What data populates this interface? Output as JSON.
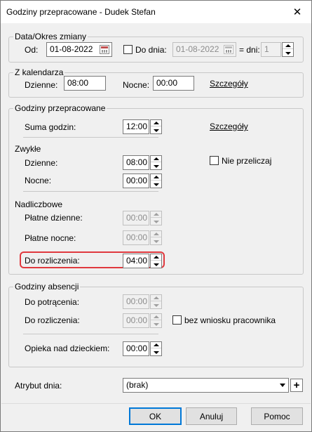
{
  "window": {
    "title": "Godziny przepracowane - Dudek Stefan",
    "close": "✕"
  },
  "data_okres": {
    "legend": "Data/Okres zmiany",
    "od_label": "Od:",
    "od_value": "01-08-2022",
    "do_dnia_label": "Do dnia:",
    "do_dnia_checked": false,
    "do_dnia_value": "01-08-2022",
    "dni_label": "= dni:",
    "dni_value": "1"
  },
  "z_kalendarza": {
    "legend": "Z kalendarza",
    "dzienne_label": "Dzienne:",
    "dzienne_value": "08:00",
    "nocne_label": "Nocne:",
    "nocne_value": "00:00",
    "szczegoly": "Szczegóły"
  },
  "godziny_przepracowane": {
    "legend": "Godziny przepracowane",
    "suma_label": "Suma godzin:",
    "suma_value": "12:00",
    "szczegoly": "Szczegóły",
    "zwykle_label": "Zwykłe",
    "dzienne_label": "Dzienne:",
    "dzienne_value": "08:00",
    "nocne_label": "Nocne:",
    "nocne_value": "00:00",
    "nie_przeliczaj_label": "Nie przeliczaj",
    "nadliczbowe_label": "Nadliczbowe",
    "platne_dzienne_label": "Płatne dzienne:",
    "platne_dzienne_value": "00:00",
    "platne_nocne_label": "Płatne nocne:",
    "platne_nocne_value": "00:00",
    "do_rozliczenia_label": "Do rozliczenia:",
    "do_rozliczenia_value": "04:00"
  },
  "godziny_absencji": {
    "legend": "Godziny absencji",
    "do_potracenia_label": "Do potrącenia:",
    "do_potracenia_value": "00:00",
    "do_rozliczenia_label": "Do rozliczenia:",
    "do_rozliczenia_value": "00:00",
    "bez_wniosku_label": "bez wniosku pracownika",
    "opieka_label": "Opieka nad dzieckiem:",
    "opieka_value": "00:00"
  },
  "atrybut": {
    "label": "Atrybut dnia:",
    "value": "(brak)",
    "plus": "+"
  },
  "buttons": {
    "ok": "OK",
    "anuluj": "Anuluj",
    "pomoc": "Pomoc"
  },
  "colors": {
    "highlight": "#e0393e",
    "accent": "#0078d7"
  }
}
